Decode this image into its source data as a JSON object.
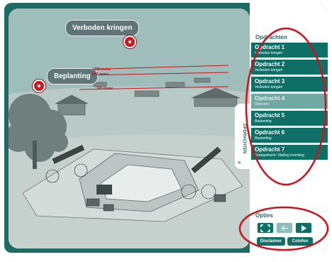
{
  "scene": {
    "callouts": {
      "verboden": "Verboden kringen",
      "beplanting": "Beplanting"
    },
    "distances": [
      "1000 meter",
      "600 meter",
      "300 meter"
    ]
  },
  "panel": {
    "title": "Opdrachten",
    "tasks": [
      {
        "title": "Opdracht 1",
        "subtitle": "Verboden kringen",
        "active": true
      },
      {
        "title": "Opdracht 2",
        "subtitle": "Verboden kringen",
        "active": true
      },
      {
        "title": "Opdracht 3",
        "subtitle": "Verboden kringen",
        "active": true
      },
      {
        "title": "Opdracht 4",
        "subtitle": "Wanzens",
        "active": false
      },
      {
        "title": "Opdracht 5",
        "subtitle": "Beplanting",
        "active": true
      },
      {
        "title": "Opdracht 6",
        "subtitle": "Beplanting",
        "active": true
      },
      {
        "title": "Opdracht 7",
        "subtitle": "Eindopdracht: Stelling inrichting",
        "active": true
      }
    ]
  },
  "vtab": {
    "label": "OPDRACHTEN",
    "arrow": "«"
  },
  "options": {
    "title": "Opties",
    "disclaimer": "Disclaimer",
    "calculate": "Colofon"
  },
  "colors": {
    "frame": "#1e6b66",
    "task": "#0d6f66",
    "task_dim": "#6fa9a2",
    "annotation": "#d0101a"
  },
  "icons": [
    "fullscreen-icon",
    "back-arrow-icon",
    "play-icon",
    "target-icon"
  ]
}
